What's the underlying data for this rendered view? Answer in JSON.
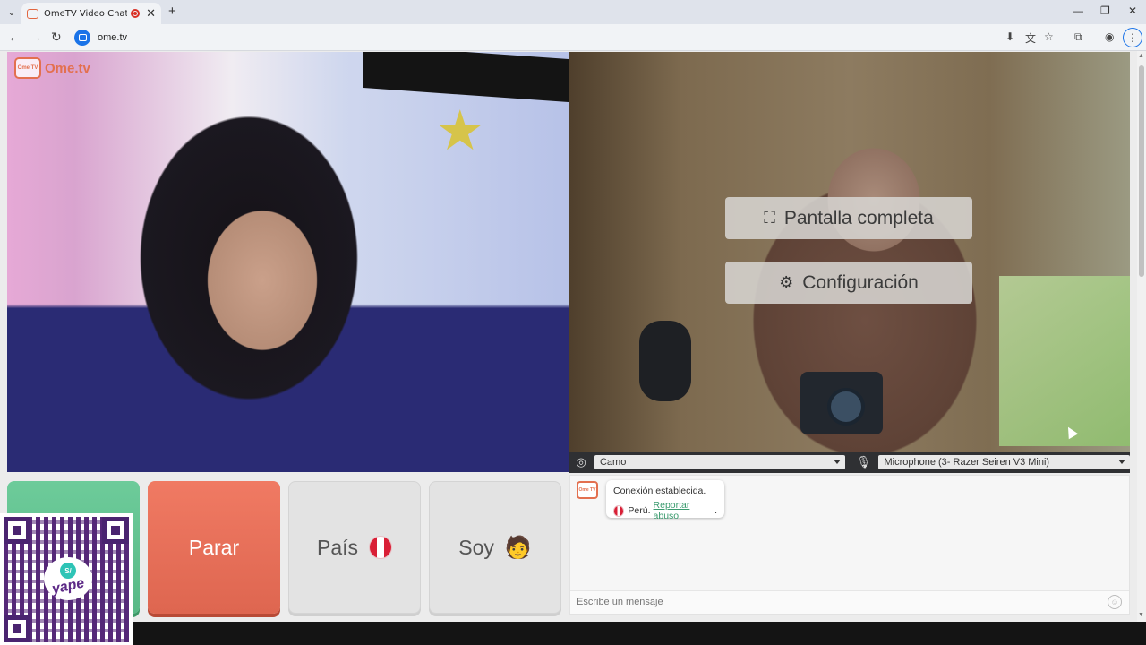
{
  "browser": {
    "tab_title": "OmeTV Video Chat — Ome",
    "tab_close": "✕",
    "new_tab": "+",
    "url": "ome.tv",
    "window_controls": [
      "—",
      "❐",
      "✕"
    ]
  },
  "brand": {
    "logo_badge": "Ome TV",
    "logo_text": "Ome.tv",
    "accent_color": "#e3704f"
  },
  "overlay_menu": {
    "fullscreen_label": "Pantalla completa",
    "settings_label": "Configuración"
  },
  "devices": {
    "camera": "Camo",
    "microphone": "Microphone (3- Razer Seiren V3 Mini)"
  },
  "actions": {
    "stop_label": "Parar",
    "country_label": "País",
    "gender_label": "Soy",
    "gender_icon": "🧑"
  },
  "qr": {
    "brand": "yape",
    "coin": "S/"
  },
  "chat": {
    "messages": [
      {
        "status": "Conexión establecida.",
        "country": "Perú.",
        "report_link": "Reportar abuso",
        "suffix": "."
      }
    ],
    "input_placeholder": "Escribe un mensaje"
  }
}
